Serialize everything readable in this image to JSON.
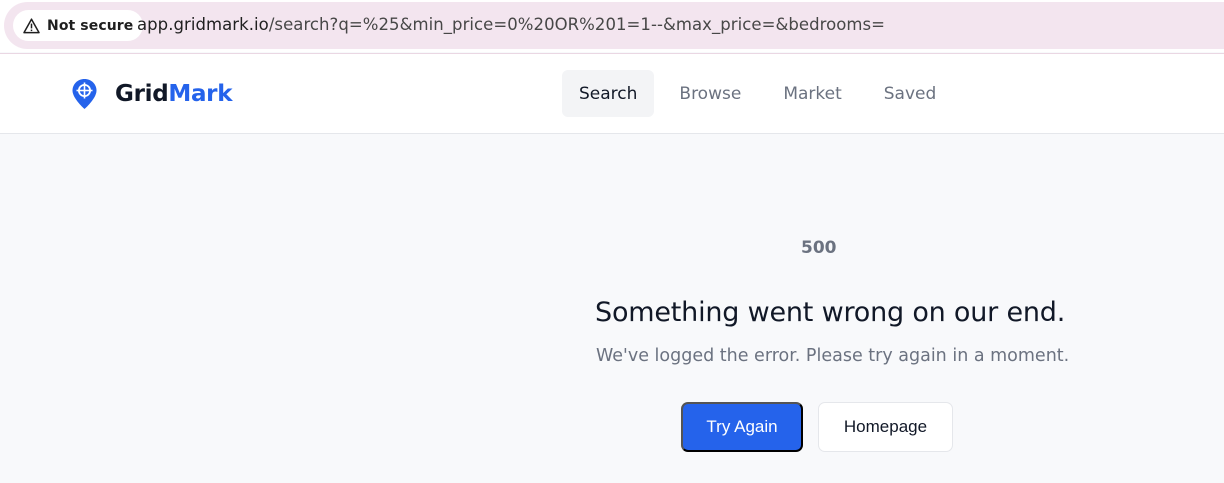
{
  "browser": {
    "security_label": "Not secure",
    "url_host": "app.gridmark.io",
    "url_rest": "/search?q=%25&min_price=0%20OR%201=1--&max_price=&bedrooms="
  },
  "brand": {
    "name_primary": "Grid",
    "name_accent": "Mark",
    "accent_color": "#2563eb"
  },
  "nav": {
    "tabs": [
      {
        "label": "Search",
        "active": true
      },
      {
        "label": "Browse",
        "active": false
      },
      {
        "label": "Market",
        "active": false
      },
      {
        "label": "Saved",
        "active": false
      }
    ]
  },
  "error": {
    "code": "500",
    "headline": "Something went wrong on our end.",
    "message": "We've logged the error. Please try again in a moment.",
    "primary_button": "Try Again",
    "secondary_button": "Homepage"
  }
}
